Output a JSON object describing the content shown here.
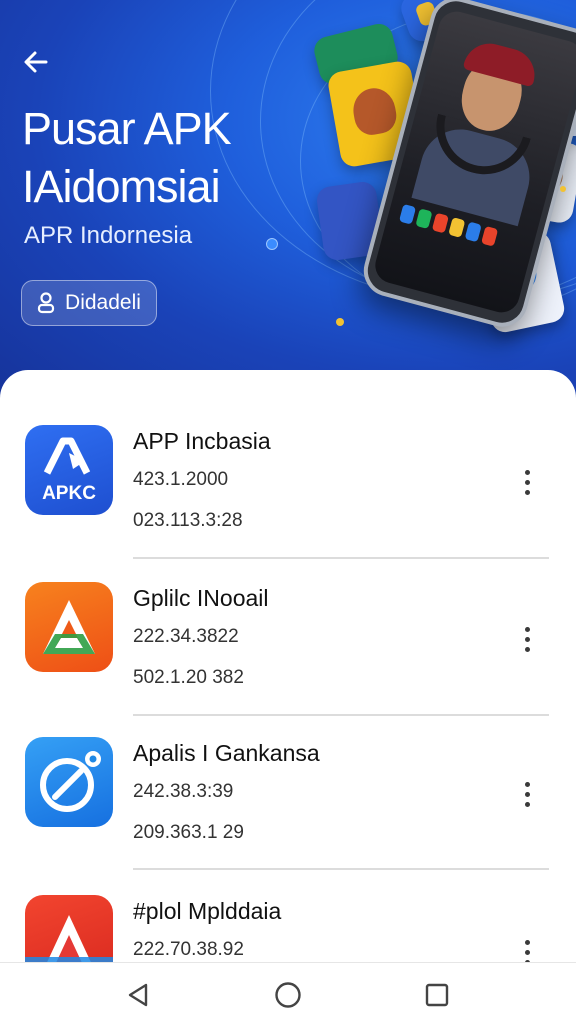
{
  "header": {
    "back_icon": "arrow-left-icon",
    "title_line1": "Pusar APK",
    "title_line2": "IAidomsiai",
    "subtitle": "APR Indornesia",
    "button_label": "Didadeli",
    "button_icon": "person-icon"
  },
  "apps": [
    {
      "name": "APP Incbasia",
      "meta1": "423.1.2000",
      "meta2": "023.113.3:28",
      "icon_text": "APKC",
      "icon": "apkc-logo-icon",
      "color": "#2563eb"
    },
    {
      "name": "Gplilc INooail",
      "meta1": "222.34.3822",
      "meta2": "502.1.20 382",
      "icon": "triangle-logo-icon",
      "color": "#f05a1a"
    },
    {
      "name": "Apalis I Gankansa",
      "meta1": "242.38.3:39",
      "meta2": "209.363.1 29",
      "icon": "clock-logo-icon",
      "color": "#1e88e5"
    },
    {
      "name": "#plol Mplddaia",
      "meta1": "222.70.38.92",
      "icon": "red-triangle-logo-icon",
      "color": "#e53935"
    }
  ],
  "navbar": {
    "back": "triangle-back-icon",
    "home": "circle-home-icon",
    "recents": "square-recents-icon"
  }
}
